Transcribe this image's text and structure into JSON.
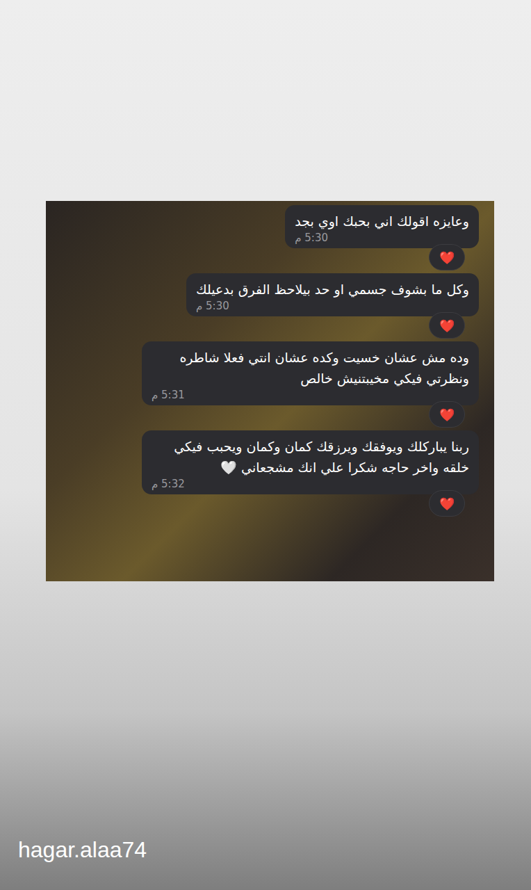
{
  "story": {
    "username": "hagar.alaa74"
  },
  "chat": {
    "messages": [
      {
        "text": "وعايزه اقولك اني بحبك اوي بجد",
        "time": "5:30 م",
        "reaction": "❤️"
      },
      {
        "text": "وكل ما بشوف جسمي او حد بيلاحظ الفرق بدعيلك",
        "time": "5:30 م",
        "reaction": "❤️"
      },
      {
        "text": "وده مش عشان خسيت وكده عشان انتي فعلا شاطره ونظرتي فيكي مخيبتنيش خالص",
        "time": "5:31 م",
        "reaction": "❤️"
      },
      {
        "text": "ربنا يباركلك ويوفقك ويرزقك كمان وكمان ويحبب فيكي خلقه واخر حاجه شكرا علي انك مشجعاني 🤍",
        "time": "5:32 م",
        "reaction": "❤️"
      }
    ]
  }
}
